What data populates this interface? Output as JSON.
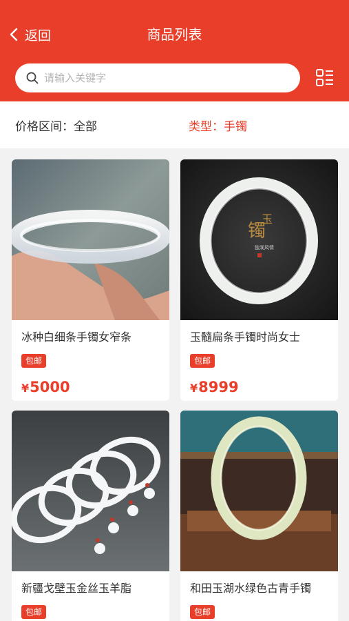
{
  "header": {
    "back_label": "返回",
    "title": "商品列表",
    "search_placeholder": "请输入关键字"
  },
  "filter": {
    "price_label": "价格区间：全部",
    "type_label": "类型：手镯"
  },
  "products": [
    {
      "name": "冰种白细条手镯女窄条",
      "tag": "包邮",
      "currency": "¥",
      "price": "5000",
      "image": "icy-white-bangle"
    },
    {
      "name": "玉髓扁条手镯时尚女士",
      "tag": "包邮",
      "currency": "¥",
      "price": "8999",
      "image": "chalcedony-bangle"
    },
    {
      "name": "新疆戈壁玉金丝玉羊脂",
      "tag": "包邮",
      "currency": "¥",
      "price": "",
      "image": "gobi-jade-bangles"
    },
    {
      "name": "和田玉湖水绿色古青手镯",
      "tag": "包邮",
      "currency": "¥",
      "price": "",
      "image": "hetian-jade-bangle"
    }
  ],
  "colors": {
    "brand": "#e83e2a",
    "background": "#f2f2f2"
  },
  "icons": [
    "chevron-left-icon",
    "search-icon",
    "list-view-icon"
  ]
}
